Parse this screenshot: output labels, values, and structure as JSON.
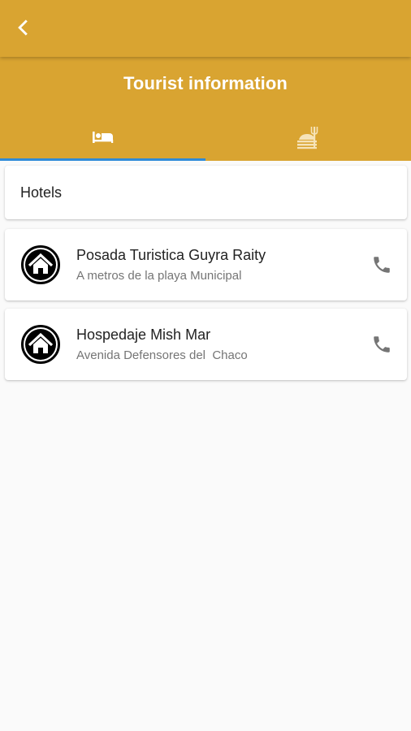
{
  "appbar": {
    "back_icon": "chevron-left-icon"
  },
  "header": {
    "title": "Tourist information"
  },
  "tabs": [
    {
      "name": "hotels",
      "icon": "bed-icon",
      "selected": true
    },
    {
      "name": "restaurants",
      "icon": "restaurant-icon",
      "selected": false
    }
  ],
  "section": {
    "title": "Hotels"
  },
  "hotels": [
    {
      "name": "Posada Turistica Guyra Raity",
      "address": "A metros de la playa Municipal",
      "icon": "home-icon",
      "action_icon": "phone-icon"
    },
    {
      "name": "Hospedaje Mish Mar",
      "address": "Avenida Defensores del  Chaco",
      "icon": "home-icon",
      "action_icon": "phone-icon"
    }
  ],
  "colors": {
    "primary": "#d9a431",
    "tab_indicator": "#2f8bd8",
    "background": "#fafafa",
    "text_primary": "#222222",
    "text_secondary": "#757575",
    "icon_gray": "#757575"
  }
}
